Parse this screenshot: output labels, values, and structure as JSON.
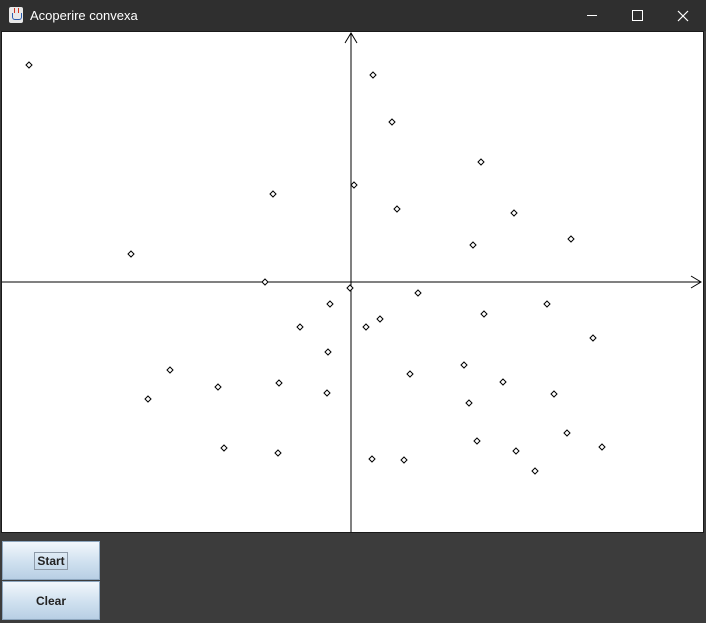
{
  "window": {
    "title": "Acoperire convexa",
    "app_icon": "java-cup-icon"
  },
  "controls": {
    "minimize_icon": "minimize-icon",
    "maximize_icon": "maximize-icon",
    "close_icon": "close-icon"
  },
  "canvas": {
    "background": "#ffffff",
    "axis_color": "#000000",
    "points": [
      [
        -322,
        217
      ],
      [
        22,
        207
      ],
      [
        41,
        160
      ],
      [
        130,
        120
      ],
      [
        -78,
        88
      ],
      [
        3,
        97
      ],
      [
        46,
        73
      ],
      [
        163,
        69
      ],
      [
        122,
        37
      ],
      [
        220,
        43
      ],
      [
        -220,
        28
      ],
      [
        -86,
        0
      ],
      [
        -1,
        -6
      ],
      [
        67,
        -11
      ],
      [
        -21,
        -22
      ],
      [
        196,
        -22
      ],
      [
        -51,
        -45
      ],
      [
        15,
        -45
      ],
      [
        29,
        -37
      ],
      [
        133,
        -32
      ],
      [
        242,
        -56
      ],
      [
        -23,
        -70
      ],
      [
        113,
        -83
      ],
      [
        -181,
        -88
      ],
      [
        59,
        -92
      ],
      [
        152,
        -100
      ],
      [
        -133,
        -105
      ],
      [
        -72,
        -101
      ],
      [
        -24,
        -111
      ],
      [
        -203,
        -117
      ],
      [
        203,
        -112
      ],
      [
        118,
        -121
      ],
      [
        216,
        -151
      ],
      [
        126,
        -159
      ],
      [
        -127,
        -166
      ],
      [
        251,
        -165
      ],
      [
        -73,
        -171
      ],
      [
        165,
        -169
      ],
      [
        21,
        -177
      ],
      [
        53,
        -178
      ],
      [
        184,
        -189
      ]
    ]
  },
  "buttons": {
    "start_label": "Start",
    "clear_label": "Clear"
  }
}
